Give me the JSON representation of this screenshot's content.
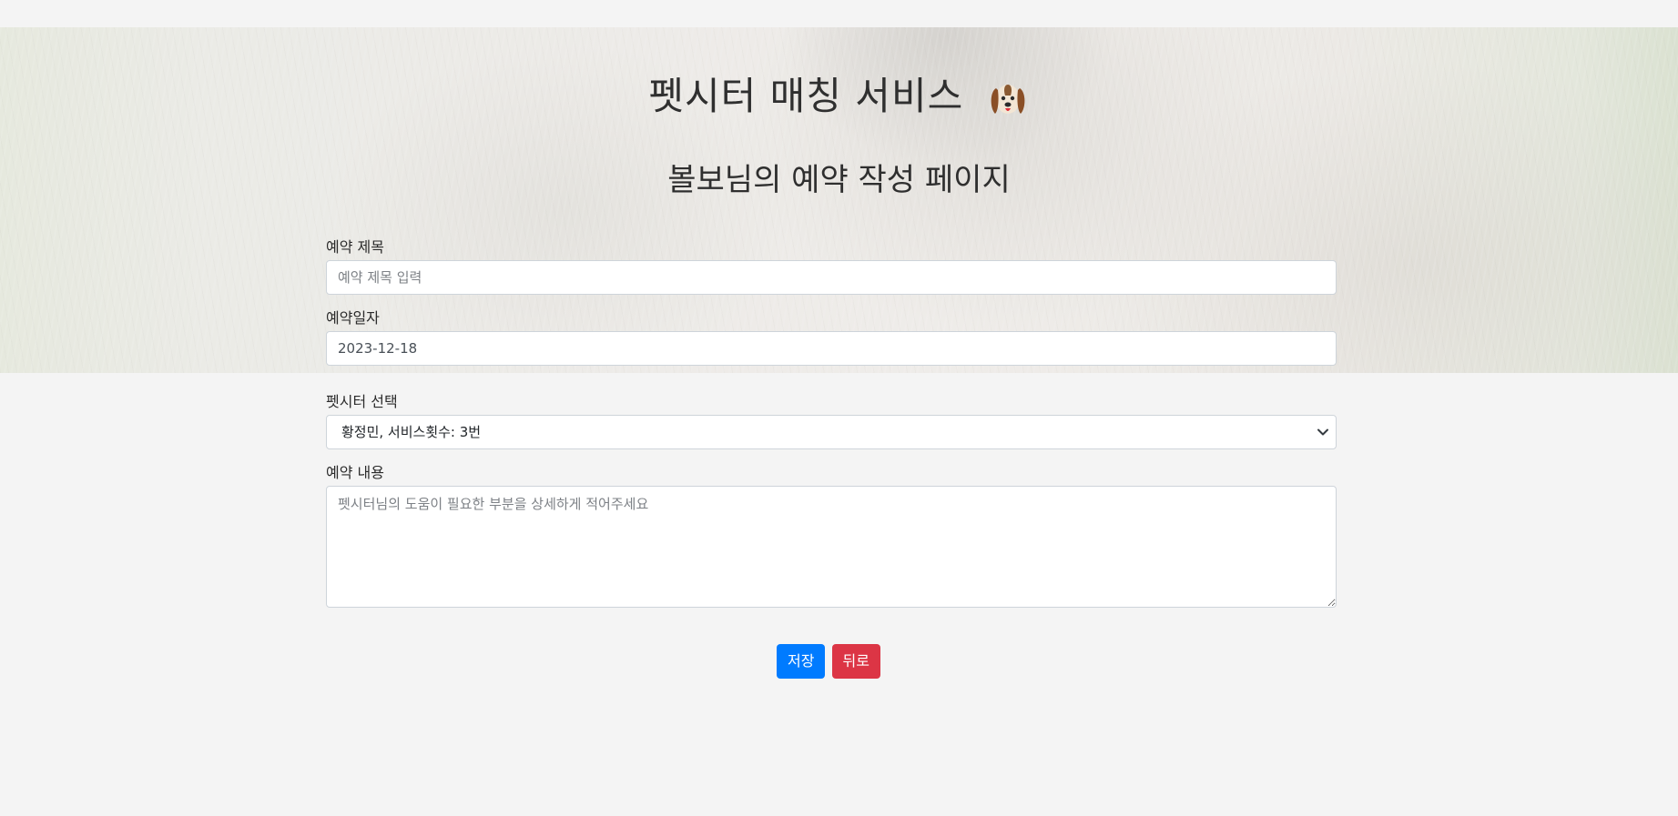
{
  "header": {
    "title": "펫시터 매칭 서비스",
    "title_icon": "dog-icon",
    "subtitle": "볼보님의 예약 작성 페이지"
  },
  "form": {
    "reservation_title": {
      "label": "예약 제목",
      "value": "",
      "placeholder": "예약 제목 입력"
    },
    "reservation_date": {
      "label": "예약일자",
      "value": "2023-12-18"
    },
    "petsitter_select": {
      "label": "펫시터 선택",
      "selected": "황정민, 서비스횟수: 3번"
    },
    "reservation_content": {
      "label": "예약 내용",
      "value": "",
      "placeholder": "펫시터님의 도움이 필요한 부분을 상세하게 적어주세요"
    }
  },
  "buttons": {
    "save_label": "저장",
    "back_label": "뒤로"
  },
  "colors": {
    "background": "#f4f4f4",
    "save_button": "#007bff",
    "back_button": "#dc3545"
  }
}
